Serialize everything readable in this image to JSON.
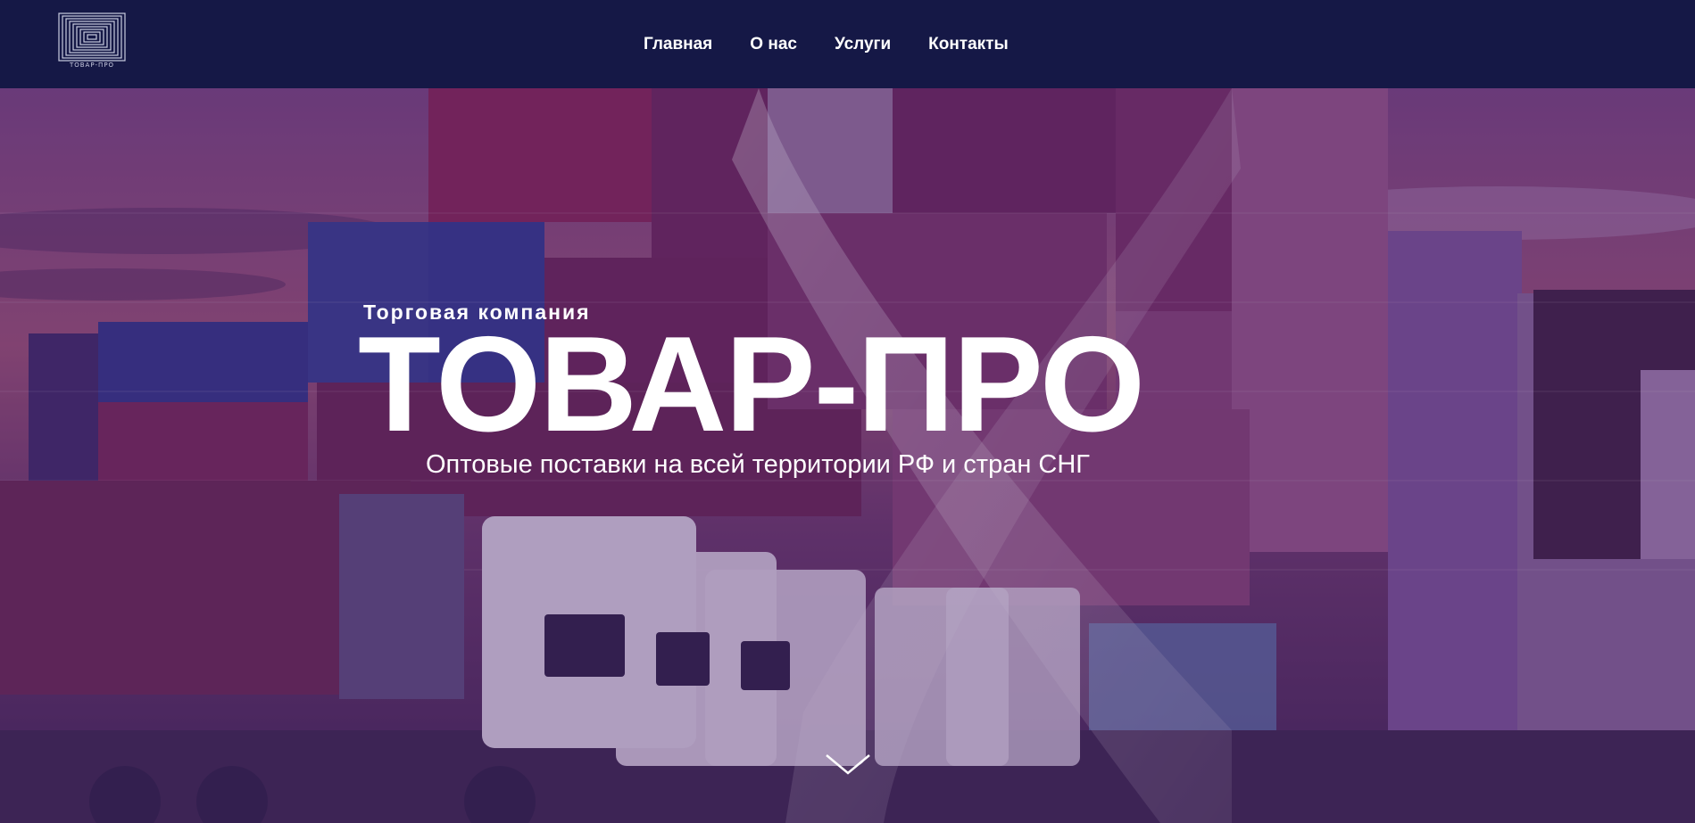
{
  "header": {
    "logo_text": "ТОВАР-ПРО",
    "nav": [
      {
        "label": "Главная"
      },
      {
        "label": "О нас"
      },
      {
        "label": "Услуги"
      },
      {
        "label": "Контакты"
      }
    ]
  },
  "hero": {
    "tagline": "Торговая компания",
    "title": "ТОВАР-ПРО",
    "subtitle": "Оптовые поставки на всей территории РФ и стран СНГ"
  },
  "icons": {
    "logo": "concentric-squares-logo-icon",
    "scroll": "chevron-down-icon"
  },
  "colors": {
    "header_bg": "#151846",
    "text": "#ffffff",
    "overlay": "#46186a"
  }
}
